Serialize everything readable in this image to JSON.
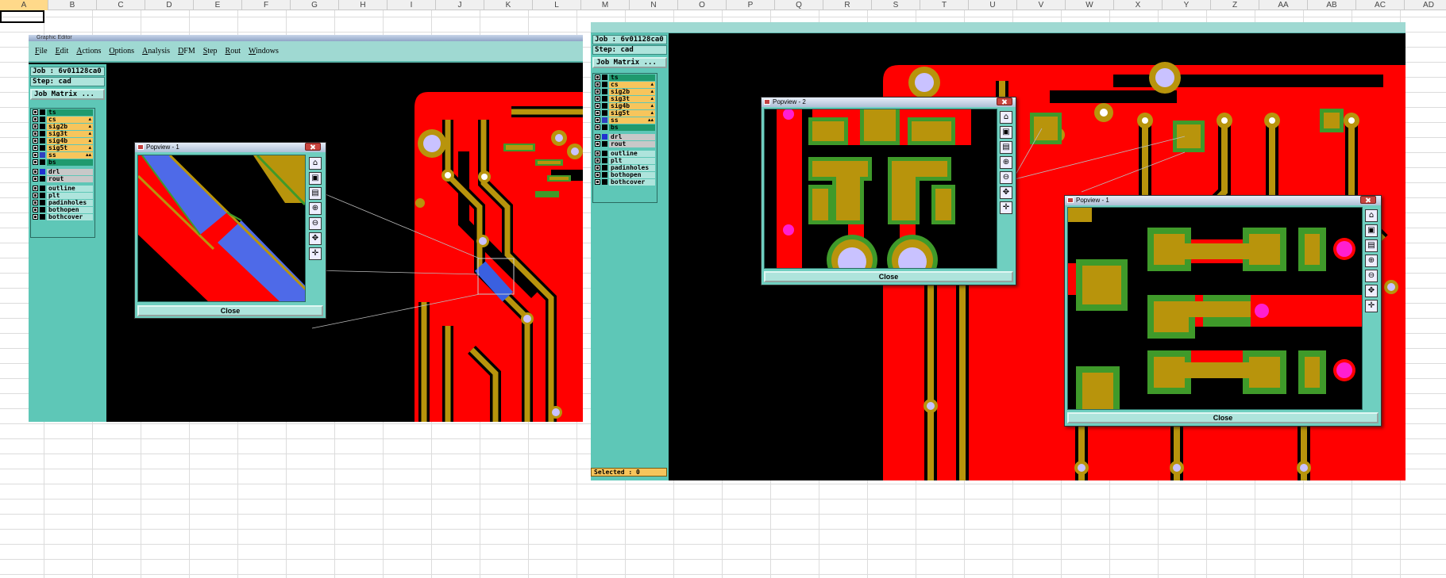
{
  "spreadsheet": {
    "columns": [
      "A",
      "B",
      "C",
      "D",
      "E",
      "F",
      "G",
      "H",
      "I",
      "J",
      "K",
      "L",
      "M",
      "N",
      "O",
      "P",
      "Q",
      "R",
      "S",
      "T",
      "U",
      "V",
      "W",
      "X",
      "Y",
      "Z",
      "AA",
      "AB",
      "AC",
      "AD"
    ]
  },
  "left_window": {
    "title": "Graphic Editor",
    "menu": [
      "File",
      "Edit",
      "Actions",
      "Options",
      "Analysis",
      "DFM",
      "Step",
      "Rout",
      "Windows"
    ],
    "job": "Job : 6v01128ca0",
    "step": "Step: cad",
    "matrix_button": "Job Matrix ...",
    "layers": [
      {
        "name": "ts",
        "color": "#1f9a6e",
        "swatch": "#000"
      },
      {
        "name": "cs",
        "color": "#f7c55c",
        "swatch": "#000",
        "lock": "▴"
      },
      {
        "name": "sig2b",
        "color": "#f7c55c",
        "swatch": "#000",
        "lock": "▴"
      },
      {
        "name": "sig3t",
        "color": "#f7c55c",
        "swatch": "#000",
        "lock": "▴"
      },
      {
        "name": "sig4b",
        "color": "#f7c55c",
        "swatch": "#000",
        "lock": "▴"
      },
      {
        "name": "sig5t",
        "color": "#f7c55c",
        "swatch": "#000",
        "lock": "▴"
      },
      {
        "name": "ss",
        "color": "#f7c55c",
        "swatch": "#3040c0",
        "lock": "▴▴"
      },
      {
        "name": "bs",
        "color": "#1f9a6e",
        "swatch": "#000"
      },
      {
        "name": "drl",
        "color": "#c8c8c8",
        "swatch": "#2030d0"
      },
      {
        "name": "rout",
        "color": "#c8c8c8",
        "swatch": "#000"
      },
      {
        "name": "outline",
        "color": "#aee4dc",
        "swatch": "#000"
      },
      {
        "name": "plt",
        "color": "#aee4dc",
        "swatch": "#000"
      },
      {
        "name": "padinholes",
        "color": "#aee4dc",
        "swatch": "#000"
      },
      {
        "name": "bothopen",
        "color": "#aee4dc",
        "swatch": "#000"
      },
      {
        "name": "bothcover",
        "color": "#aee4dc",
        "swatch": "#000"
      }
    ],
    "popup": {
      "title": "Popview - 1",
      "close": "Close"
    }
  },
  "right_window": {
    "job": "Job : 6v01128ca0",
    "step": "Step: cad",
    "matrix_button": "Job Matrix ...",
    "layers": [
      {
        "name": "ts",
        "color": "#1f9a6e",
        "swatch": "#000"
      },
      {
        "name": "cs",
        "color": "#f7c55c",
        "swatch": "#000",
        "lock": "▴"
      },
      {
        "name": "sig2b",
        "color": "#f7c55c",
        "swatch": "#000",
        "lock": "▴"
      },
      {
        "name": "sig3t",
        "color": "#f7c55c",
        "swatch": "#000",
        "lock": "▴"
      },
      {
        "name": "sig4b",
        "color": "#f7c55c",
        "swatch": "#000",
        "lock": "▴"
      },
      {
        "name": "sig5t",
        "color": "#f7c55c",
        "swatch": "#000",
        "lock": "▴"
      },
      {
        "name": "ss",
        "color": "#f7c55c",
        "swatch": "#3040c0",
        "lock": "▴▴"
      },
      {
        "name": "bs",
        "color": "#1f9a6e",
        "swatch": "#000"
      },
      {
        "name": "drl",
        "color": "#c8c8c8",
        "swatch": "#2030d0"
      },
      {
        "name": "rout",
        "color": "#c8c8c8",
        "swatch": "#000"
      },
      {
        "name": "outline",
        "color": "#aee4dc",
        "swatch": "#000"
      },
      {
        "name": "plt",
        "color": "#aee4dc",
        "swatch": "#000"
      },
      {
        "name": "padinholes",
        "color": "#aee4dc",
        "swatch": "#000"
      },
      {
        "name": "bothopen",
        "color": "#aee4dc",
        "swatch": "#000"
      },
      {
        "name": "bothcover",
        "color": "#aee4dc",
        "swatch": "#000"
      }
    ],
    "popup1": {
      "title": "Popview - 1",
      "close": "Close"
    },
    "popup2": {
      "title": "Popview - 2",
      "close": "Close"
    },
    "status": "Selected : 0"
  },
  "colors": {
    "board_red": "#ff0000",
    "copper": "#b8940c",
    "mask_green": "#3f9a2a",
    "pad_lavender": "#c9c2ff",
    "via_magenta": "#ff1fd0",
    "ui_teal": "#6fcfc0"
  }
}
